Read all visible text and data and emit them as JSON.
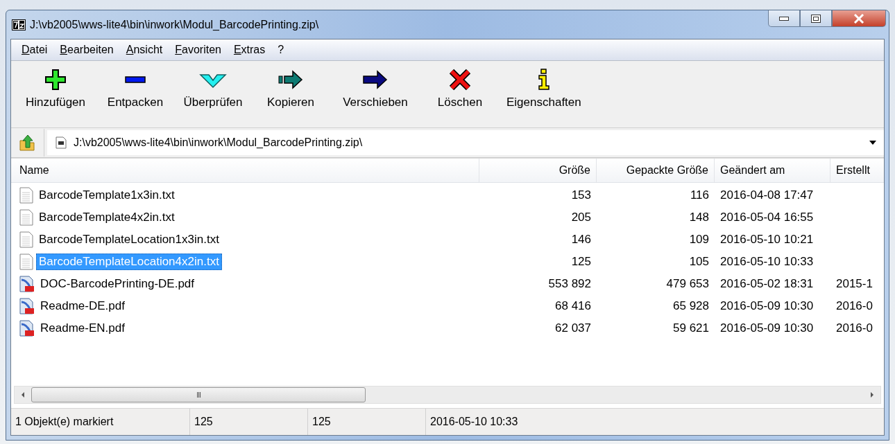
{
  "window": {
    "title": "J:\\vb2005\\wws-lite4\\bin\\inwork\\Modul_BarcodePrinting.zip\\"
  },
  "menu": [
    "Datei",
    "Bearbeiten",
    "Ansicht",
    "Favoriten",
    "Extras",
    "?"
  ],
  "toolbar": [
    {
      "kind": "add",
      "label": "Hinzufügen"
    },
    {
      "kind": "extract",
      "label": "Entpacken"
    },
    {
      "kind": "test",
      "label": "Überprüfen"
    },
    {
      "kind": "copy",
      "label": "Kopieren"
    },
    {
      "kind": "move",
      "label": "Verschieben"
    },
    {
      "kind": "delete",
      "label": "Löschen"
    },
    {
      "kind": "info",
      "label": "Eigenschaften"
    }
  ],
  "address": {
    "value": "J:\\vb2005\\wws-lite4\\bin\\inwork\\Modul_BarcodePrinting.zip\\"
  },
  "table": {
    "columns": [
      "Name",
      "Größe",
      "Gepackte Größe",
      "Geändert am",
      "Erstellt"
    ],
    "rows": [
      {
        "kind": "txt",
        "name": "BarcodeTemplate1x3in.txt",
        "size": "153",
        "packed": "116",
        "modified": "2016-04-08 17:47",
        "created": "",
        "selected": false
      },
      {
        "kind": "txt",
        "name": "BarcodeTemplate4x2in.txt",
        "size": "205",
        "packed": "148",
        "modified": "2016-05-04 16:55",
        "created": "",
        "selected": false
      },
      {
        "kind": "txt",
        "name": "BarcodeTemplateLocation1x3in.txt",
        "size": "146",
        "packed": "109",
        "modified": "2016-05-10 10:21",
        "created": "",
        "selected": false
      },
      {
        "kind": "txt",
        "name": "BarcodeTemplateLocation4x2in.txt",
        "size": "125",
        "packed": "105",
        "modified": "2016-05-10 10:33",
        "created": "",
        "selected": true
      },
      {
        "kind": "pdf",
        "name": "DOC-BarcodePrinting-DE.pdf",
        "size": "553 892",
        "packed": "479 653",
        "modified": "2016-05-02 18:31",
        "created": "2015-1",
        "selected": false
      },
      {
        "kind": "pdf",
        "name": "Readme-DE.pdf",
        "size": "68 416",
        "packed": "65 928",
        "modified": "2016-05-09 10:30",
        "created": "2016-0",
        "selected": false
      },
      {
        "kind": "pdf",
        "name": "Readme-EN.pdf",
        "size": "62 037",
        "packed": "59 621",
        "modified": "2016-05-09 10:30",
        "created": "2016-0",
        "selected": false
      }
    ]
  },
  "scrollbar": {
    "grip": "III"
  },
  "status_bar": [
    "1 Objekt(e) markiert",
    "125",
    "125",
    "2016-05-10 10:33"
  ]
}
